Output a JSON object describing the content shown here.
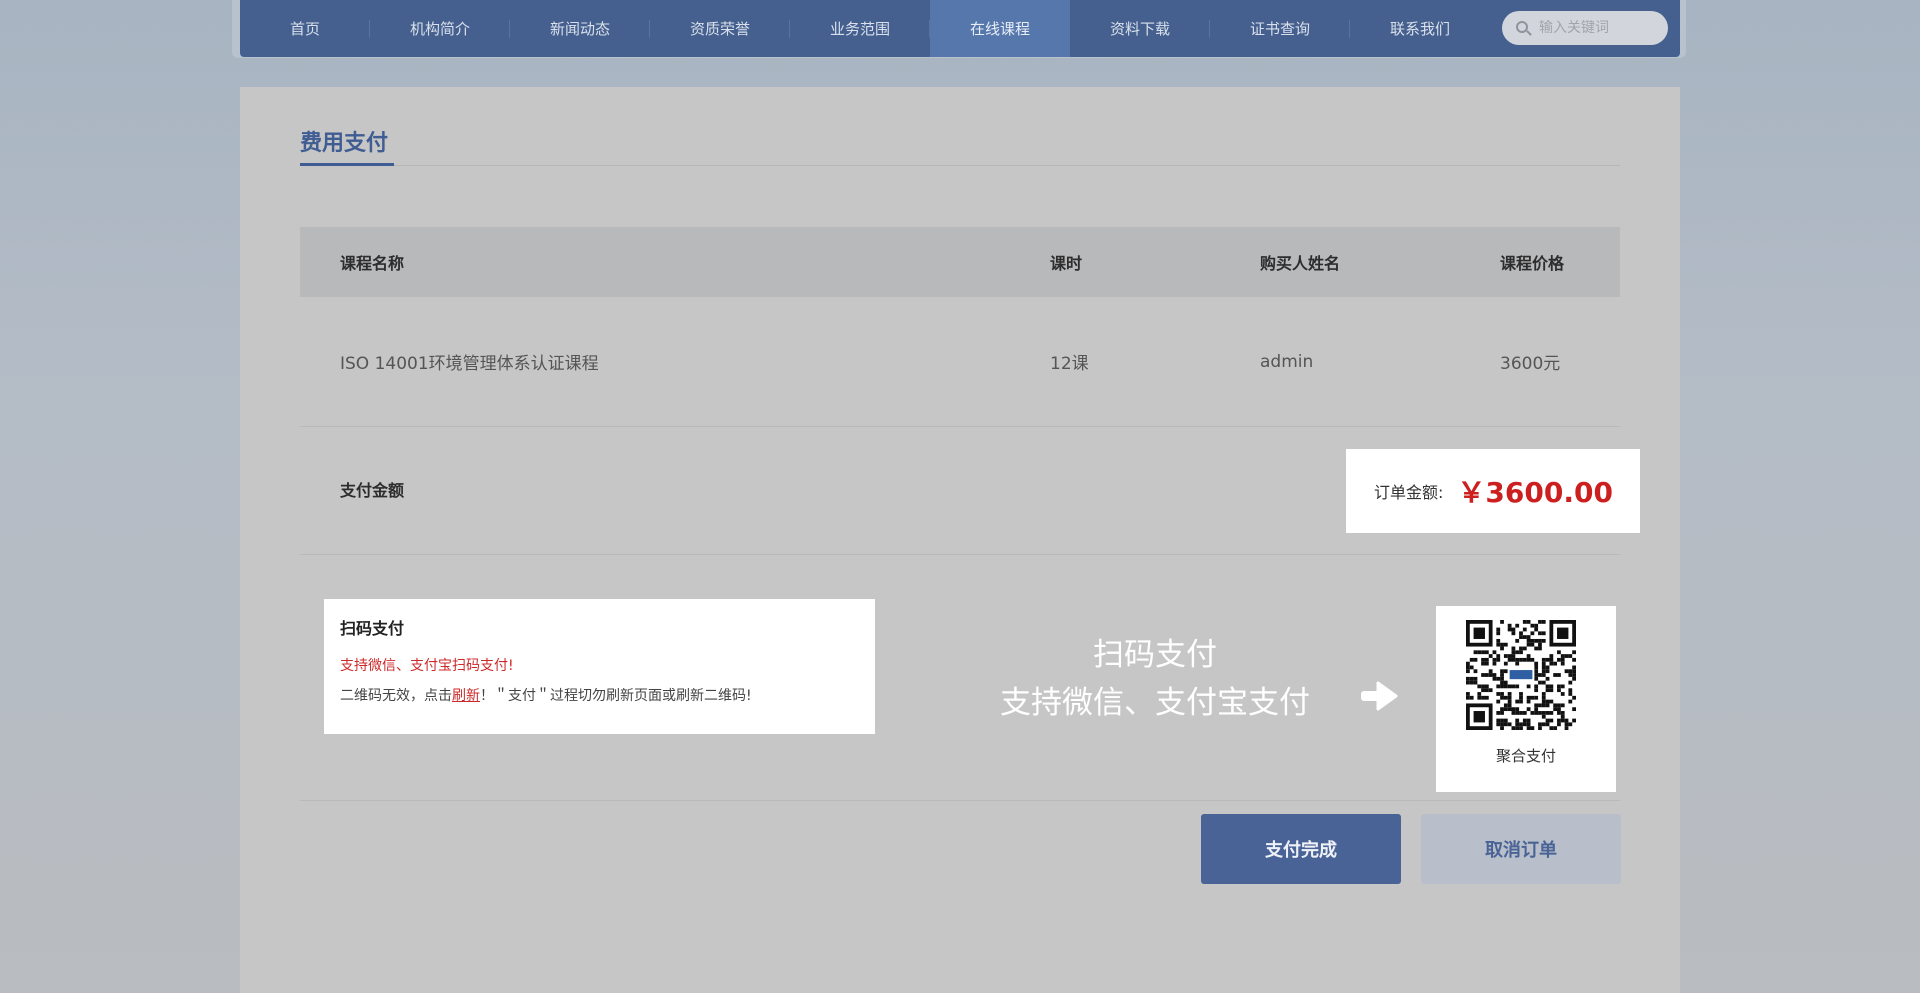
{
  "nav": {
    "items": [
      {
        "label": "首页"
      },
      {
        "label": "机构简介"
      },
      {
        "label": "新闻动态"
      },
      {
        "label": "资质荣誉"
      },
      {
        "label": "业务范围"
      },
      {
        "label": "在线课程",
        "active": true
      },
      {
        "label": "资料下载"
      },
      {
        "label": "证书查询"
      },
      {
        "label": "联系我们"
      }
    ],
    "search": {
      "placeholder": "输入关键词",
      "icon": "search-icon"
    }
  },
  "page": {
    "title": "费用支付"
  },
  "table": {
    "headers": [
      "课程名称",
      "课时",
      "购买人姓名",
      "课程价格"
    ],
    "rows": [
      {
        "course": "ISO 14001环境管理体系认证课程",
        "hours": "12课",
        "buyer": "admin",
        "price": "3600元"
      }
    ]
  },
  "amount": {
    "label": "支付金额",
    "order_label": "订单金额:",
    "order_value": "￥3600.00"
  },
  "pay": {
    "info_title": "扫码支付",
    "info_support": "支持微信、支付宝扫码支付!",
    "info_note_prefix": "二维码无效，点击",
    "info_note_link": "刷新",
    "info_note_suffix": "！＂支付＂过程切勿刷新页面或刷新二维码!",
    "big_line1": "扫码支付",
    "big_line2": "支持微信、支付宝支付",
    "qr_label": "聚合支付"
  },
  "buttons": {
    "done": "支付完成",
    "cancel": "取消订单"
  },
  "colors": {
    "nav_bg": "#45608e",
    "nav_active": "#5577ab",
    "accent": "#3f5d93",
    "price_red": "#cc1f1f"
  }
}
